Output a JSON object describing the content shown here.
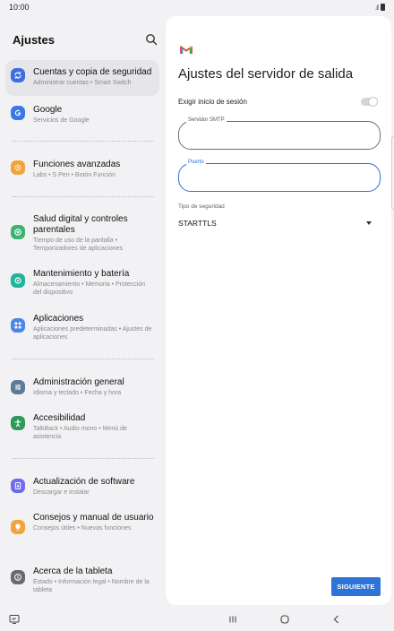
{
  "status_bar": {
    "time": "10:00",
    "signal": ".ıl"
  },
  "left": {
    "title": "Ajustes",
    "items": [
      {
        "title": "Cuentas y copia de seguridad",
        "subtitle": "Administrar cuentas • Smart Switch",
        "icon": "sync-icon",
        "color": "#3d6fe0",
        "active": true
      },
      {
        "title": "Google",
        "subtitle": "Servicios de Google",
        "icon": "google-icon",
        "color": "#3b78e7"
      },
      {
        "title": "Funciones avanzadas",
        "subtitle": "Labs • S Pen • Botón Función",
        "icon": "gear-icon",
        "color": "#f2a33a"
      },
      {
        "title": "Salud digital y controles parentales",
        "subtitle": "Tiempo de uso de la pantalla • Temporizadores de aplicaciones",
        "icon": "heart-icon",
        "color": "#3cb371"
      },
      {
        "title": "Mantenimiento y batería",
        "subtitle": "Almacenamiento • Memoria • Protección del dispositivo",
        "icon": "refresh-icon",
        "color": "#1fb59a"
      },
      {
        "title": "Aplicaciones",
        "subtitle": "Aplicaciones predeterminadas • Ajustes de aplicaciones",
        "icon": "apps-icon",
        "color": "#4b86e8"
      },
      {
        "title": "Administración general",
        "subtitle": "Idioma y teclado • Fecha y hora",
        "icon": "sliders-icon",
        "color": "#5f7a99"
      },
      {
        "title": "Accesibilidad",
        "subtitle": "TalkBack • Audio mono • Menú de asistencia",
        "icon": "accessibility-icon",
        "color": "#2e9a57"
      },
      {
        "title": "Actualización de software",
        "subtitle": "Descargar e instalar",
        "icon": "update-icon",
        "color": "#6d6cf0"
      },
      {
        "title": "Consejos y manual de usuario",
        "subtitle": "Consejos útiles • Nuevas funciones",
        "icon": "lightbulb-icon",
        "color": "#f2a33a"
      },
      {
        "title": "Acerca de la tableta",
        "subtitle": "Estado • Información legal • Nombre de la tableta",
        "icon": "info-icon",
        "color": "#6a6a70"
      }
    ]
  },
  "right": {
    "title": "Ajustes del servidor de salida",
    "auth_label": "Exigir inicio de sesión",
    "auth_enabled": false,
    "smtp_label": "Servidor SMTP",
    "smtp_value": "",
    "port_label": "Puerto",
    "port_value": "",
    "security_label": "Tipo de seguridad",
    "security_value": "STARTTLS",
    "next_label": "SIGUIENTE",
    "accent": "#2e74d8"
  }
}
